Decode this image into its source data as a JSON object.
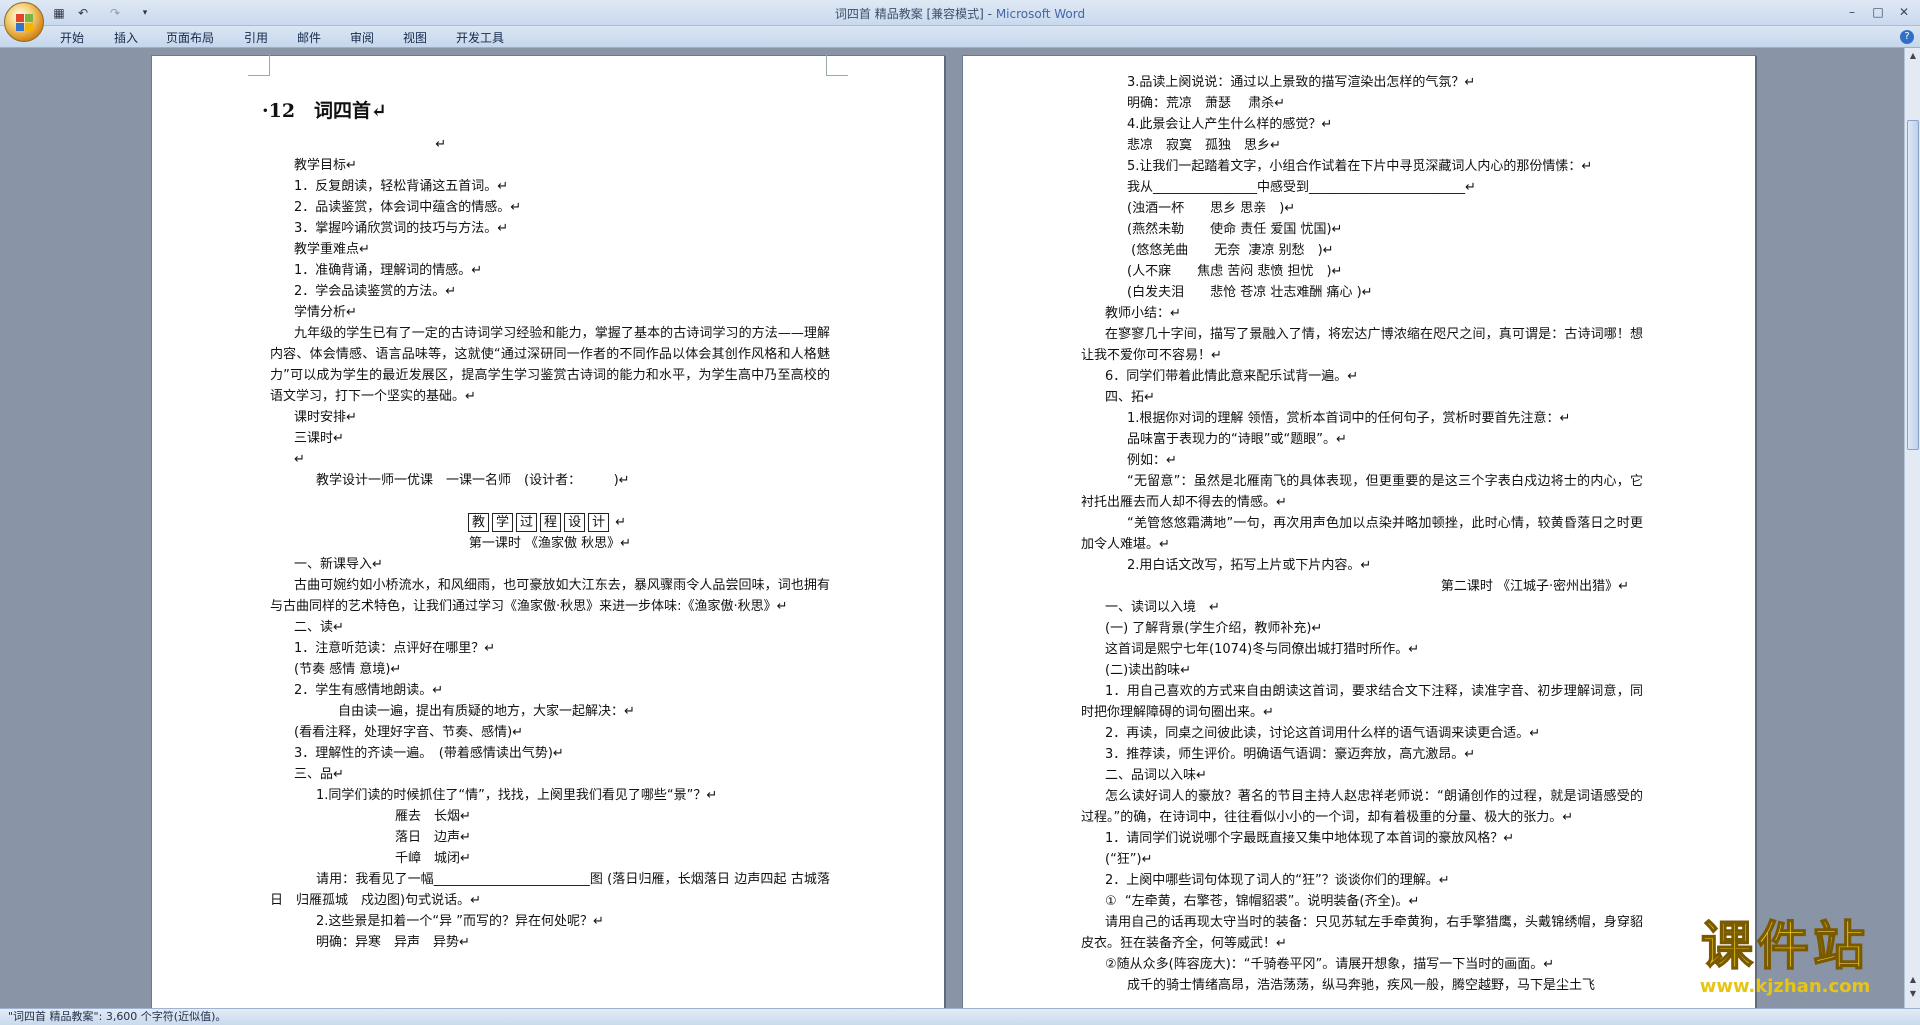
{
  "window": {
    "title": "词四首 精品教案 [兼容模式] - ",
    "app": "Microsoft Word",
    "qat": [
      "save-icon",
      "undo-icon",
      "redo-icon",
      "customize-icon"
    ]
  },
  "ribbon": {
    "tabs": [
      "开始",
      "插入",
      "页面布局",
      "引用",
      "邮件",
      "审阅",
      "视图",
      "开发工具"
    ]
  },
  "status": {
    "text": "\"词四首 精品教案\": 3,600 个字符(近似值)。"
  },
  "watermark": {
    "text": "课件站",
    "url": "www.kjzhan.com"
  },
  "left_page": {
    "title": "·12　词四首↵",
    "blocks": [
      {
        "t": "                                        ↵"
      },
      {
        "t": "教学目标↵",
        "i": 1
      },
      {
        "t": "1．反复朗读，轻松背诵这五首词。↵",
        "i": 1
      },
      {
        "t": "2．品读鉴赏，体会词中蕴含的情感。↵",
        "i": 1
      },
      {
        "t": "3．掌握吟诵欣赏词的技巧与方法。↵",
        "i": 1
      },
      {
        "t": "教学重难点↵",
        "i": 1
      },
      {
        "t": "1．准确背诵，理解词的情感。↵",
        "i": 1
      },
      {
        "t": "2．学会品读鉴赏的方法。↵",
        "i": 1
      },
      {
        "t": "学情分析↵",
        "i": 1
      },
      {
        "t": "九年级的学生已有了一定的古诗词学习经验和能力，掌握了基本的古诗词学习的方法——理解内容、体会情感、语言品味等，这就使“通过深研同一作者的不同作品以体会其创作风格和人格魅力”可以成为学生的最近发展区，提高学生学习鉴赏古诗词的能力和水平，为学生高中乃至高校的语文学习，打下一个坚实的基础。↵",
        "w": 1,
        "ind": "indent"
      },
      {
        "t": "课时安排↵",
        "i": 1
      },
      {
        "t": "三课时↵",
        "i": 1
      },
      {
        "t": "↵",
        "i": 1
      },
      {
        "t": "教学设计一师一优课　一课一名师　(设计者：　　　)↵",
        "i": 2
      },
      {
        "t": "",
        "blank": 1
      },
      {
        "t": "第一课时 《渔家傲 秋思》↵",
        "c": 1
      },
      {
        "t": "一、新课导入↵",
        "i": 1
      },
      {
        "t": "古曲可婉约如小桥流水，和风细雨，也可豪放如大江东去，暴风骤雨令人品尝回味，词也拥有与古曲同样的艺术特色，让我们通过学习《渔家傲·秋思》来进一步体味:《渔家傲·秋思》↵",
        "w": 1,
        "ind": "indent"
      },
      {
        "t": "二、读↵",
        "i": 1
      },
      {
        "t": "1．注意听范读：点评好在哪里？↵",
        "i": 1
      },
      {
        "t": "(节奏 感情 意境)↵",
        "i": 1
      },
      {
        "t": "2．学生有感情地朗读。↵",
        "i": 1
      },
      {
        "t": "自由读一遍，提出有质疑的地方，大家一起解决：↵",
        "i": 3
      },
      {
        "t": "(看看注释，处理好字音、节奏、感情)↵",
        "i": 1
      },
      {
        "t": "3．理解性的齐读一遍。　(带着感情读出气势)↵",
        "i": 1
      },
      {
        "t": "三、品↵",
        "i": 1
      },
      {
        "t": "1.同学们读的时候抓住了“情”，找找，上阕里我们看见了哪些“景”？↵",
        "i": 2
      },
      {
        "t": "雁去　长烟↵",
        "i": 5
      },
      {
        "t": "落日　边声↵",
        "i": 5
      },
      {
        "t": "千嶂　城闭↵",
        "i": 5
      },
      {
        "t": "请用：我看见了一幅________________________图 (落日归雁，长烟落日 边声四起 古城落日　归雁孤城　戍边图)句式说话。↵",
        "w": 1,
        "ind": "big"
      },
      {
        "t": "2.这些景是扣着一个“异 ”而写的？异在何处呢？↵",
        "i": 2
      },
      {
        "t": "明确：异寒　异声　异势↵",
        "i": 2
      }
    ],
    "boxed": [
      "教",
      "学",
      "过",
      "程",
      "设",
      "计"
    ]
  },
  "right_page": {
    "blocks": [
      {
        "t": "3.品读上阕说说：通过以上景致的描写渲染出怎样的气氛？↵",
        "i": 2
      },
      {
        "t": "明确：荒凉　萧瑟　 肃杀↵",
        "i": 2
      },
      {
        "t": "4.此景会让人产生什么样的感觉？↵",
        "i": 2
      },
      {
        "t": "悲凉　寂寞　孤独　思乡↵",
        "i": 2
      },
      {
        "t": "5.让我们一起踏着文字，小组合作试着在下片中寻觅深藏词人内心的那份情愫：↵",
        "i": 2
      },
      {
        "t": "我从________________中感受到________________________↵",
        "i": 2
      },
      {
        "t": "(浊酒一杯　　思乡 思亲　)↵",
        "i": 2
      },
      {
        "t": "(燕然未勒　　使命 责任 爱国 忧国)↵",
        "i": 2
      },
      {
        "t": " (悠悠羌曲　　无奈  凄凉 别愁　)↵",
        "i": 2
      },
      {
        "t": "(人不寐　　焦虑 苦闷 悲愤 担忧　)↵",
        "i": 2
      },
      {
        "t": "(白发夫泪　　悲怆 苍凉 壮志难酬 痛心 )↵",
        "i": 2
      },
      {
        "t": "教师小结：↵",
        "i": 1
      },
      {
        "t": "在寥寥几十字间，描写了景融入了情，将宏达广博浓缩在咫尺之间，真可谓是：古诗词哪！想让我不爱你可不容易！↵",
        "w": 1,
        "ind": "indent"
      },
      {
        "t": "6．同学们带着此情此意来配乐试背一遍。↵",
        "i": 1
      },
      {
        "t": "四、拓↵",
        "i": 1
      },
      {
        "t": "1.根据你对词的理解 领悟，赏析本首词中的任何句子，赏析时要首先注意：↵",
        "i": 2
      },
      {
        "t": "品味富于表现力的“诗眼”或“题眼”。↵",
        "i": 2
      },
      {
        "t": "例如：↵",
        "i": 2
      },
      {
        "t": "“无留意”：虽然是北雁南飞的具体表现，但更重要的是这三个字表白戍边将士的内心，它衬托出雁去而人却不得去的情感。↵",
        "w": 1,
        "ind": "big"
      },
      {
        "t": "“羌管悠悠霜满地”一句，再次用声色加以点染并略加顿挫，此时心情，较黄昏落日之时更加令人难堪。↵",
        "w": 1,
        "ind": "big"
      },
      {
        "t": "2.用白话文改写，拓写上片或下片内容。↵",
        "i": 2
      },
      {
        "t": "第二课时 《江城子·密州出猎》↵",
        "r": 1
      },
      {
        "t": "一、读词以入境　↵",
        "i": 1
      },
      {
        "t": "(一) 了解背景(学生介绍，教师补充)↵",
        "i": 1
      },
      {
        "t": "这首词是熙宁七年(1074)冬与同僚出城打猎时所作。↵",
        "i": 1
      },
      {
        "t": "(二)读出韵味↵",
        "i": 1
      },
      {
        "t": "1．用自己喜欢的方式来自由朗读这首词，要求结合文下注释，读准字音、初步理解词意，同时把你理解障碍的词句圈出来。↵",
        "w": 1,
        "ind": "indent"
      },
      {
        "t": "2．再读，同桌之间彼此读，讨论这首词用什么样的语气语调来读更合适。↵",
        "i": 1
      },
      {
        "t": "3．推荐读，师生评价。明确语气语调：豪迈奔放，高亢激昂。↵",
        "i": 1
      },
      {
        "t": "二、品词以入味↵",
        "i": 1
      },
      {
        "t": "怎么读好词人的豪放？著名的节目主持人赵忠祥老师说：“朗诵创作的过程，就是词语感受的过程。”的确，在诗词中，往往看似小小的一个词，却有着极重的分量、极大的张力。↵",
        "w": 1,
        "ind": "indent"
      },
      {
        "t": "1．请同学们说说哪个字最既直接又集中地体现了本首词的豪放风格？↵",
        "i": 1
      },
      {
        "t": "(“狂”)↵",
        "i": 1
      },
      {
        "t": "2．上阕中哪些词句体现了词人的“狂”？谈谈你们的理解。↵",
        "i": 1
      },
      {
        "t": "①  “左牵黄，右擎苍，锦帽貂裘”。说明装备(齐全)。↵",
        "i": 1
      },
      {
        "t": "请用自己的话再现太守当时的装备：只见苏轼左手牵黄狗，右手擎猎鹰，头戴锦绣帽，身穿貂皮衣。狂在装备齐全，何等威武！↵",
        "w": 1,
        "ind": "indent"
      },
      {
        "t": "②随从众多(阵容庞大)：“千骑卷平冈”。请展开想象，描写一下当时的画面。↵",
        "i": 1
      },
      {
        "t": "成千的骑士情绪高昂，浩浩荡荡，纵马奔驰，疾风一般，腾空越野，马下是尘土飞",
        "i": 2
      }
    ]
  }
}
